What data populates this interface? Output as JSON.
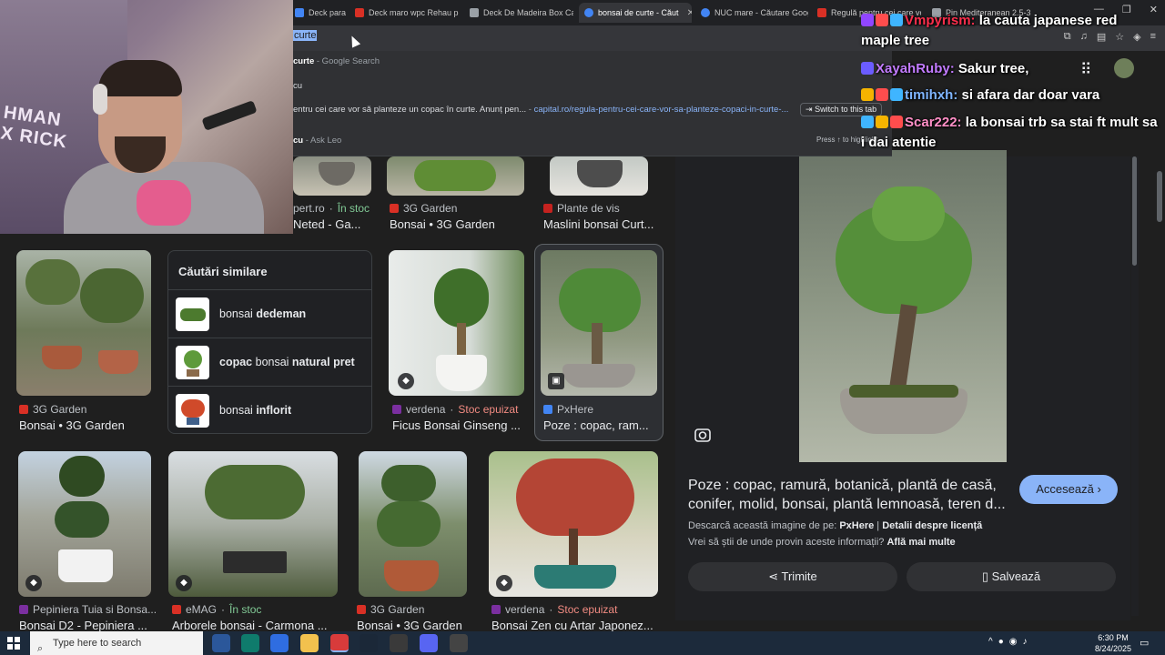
{
  "browser": {
    "tabs": [
      {
        "label": "Deck para P",
        "color": "#4285f4"
      },
      {
        "label": "Deck maro wpc Rehau pi",
        "color": "#d93025"
      },
      {
        "label": "Deck De Madeira Box Cap",
        "color": "#9aa0a6"
      },
      {
        "label": "bonsai de curte - Căut",
        "color": "#4285f4",
        "active": true
      },
      {
        "label": "NUC mare - Căutare Goog",
        "color": "#4285f4"
      },
      {
        "label": "Regulă pentru cei care vor",
        "color": "#d93025"
      },
      {
        "label": "Pin Mediteranean 2.5-3 m",
        "color": "#9aa0a6"
      }
    ],
    "omnibox_selected": "curte",
    "suggestions": {
      "s1_bold": "curte",
      "s1_rest": " - Google Search",
      "s2": "cu",
      "s3_text": "entru cei care vor să planteze un copac în curte. Anunț pen...",
      "s3_sep": " - ",
      "s3_link": "capital.ro/regula-pentru-cei-care-vor-sa-planteze-copaci-in-curte-...",
      "s4_bold": "cu",
      "s4_rest": " - Ask Leo",
      "switch_tab": "Switch to this tab",
      "press_hint": "Press ↑ to highlight"
    }
  },
  "webcam": {
    "logo_text": "HMAN X RICK"
  },
  "results": {
    "row0": [
      {
        "source": "pert.ro",
        "stock": "În stoc",
        "title": "Neted - Ga..."
      },
      {
        "source": "3G Garden",
        "title": "Bonsai • 3G Garden"
      },
      {
        "source": "Plante de vis",
        "title": "Maslini bonsai Curt..."
      }
    ],
    "row1": [
      {
        "source": "3G Garden",
        "title": "Bonsai • 3G Garden"
      },
      {
        "source": "verdena",
        "stock": "Stoc epuizat",
        "title": "Ficus Bonsai Ginseng ..."
      },
      {
        "source": "PxHere",
        "title": "Poze : copac, ram..."
      }
    ],
    "row2": [
      {
        "source": "Pepiniera Tuia si Bonsa...",
        "title": "Bonsai D2 - Pepiniera ..."
      },
      {
        "source": "eMAG",
        "stock": "În stoc",
        "title": "Arborele bonsai - Carmona ..."
      },
      {
        "source": "3G Garden",
        "title": "Bonsai • 3G Garden"
      },
      {
        "source": "verdena",
        "stock": "Stoc epuizat",
        "title": "Bonsai Zen cu Artar Japonez..."
      }
    ]
  },
  "similar": {
    "title": "Căutări similare",
    "items": [
      {
        "plain": "bonsai ",
        "bold": "dedeman",
        "plain_after": ""
      },
      {
        "plain": "",
        "bold": "copac",
        "plain_after": " bonsai ",
        "bold2": "natural pret"
      },
      {
        "plain": "bonsai ",
        "bold": "inflorit",
        "plain_after": ""
      }
    ]
  },
  "preview": {
    "title": "Poze : copac, ramură, botanică, plantă de casă, conifer, molid, bonsai, plantă lemnoasă, teren d...",
    "visit_label": "Accesează",
    "download_prefix": "Descarcă această imagine de pe: ",
    "download_source": "PxHere",
    "download_sep": " | ",
    "license": "Detalii despre licență",
    "info_prefix": "Vrei să știi de unde provin aceste informații? ",
    "info_link": "Află mai multe",
    "share_label": "Trimite",
    "save_label": "Salvează"
  },
  "chat": [
    {
      "user": "Vmpyrism:",
      "user_color": "#ff2e4c",
      "msg": " la cauta japanese red maple tree"
    },
    {
      "user": "XayahRuby:",
      "user_color": "#c27bff",
      "msg": " Sakur tree,"
    },
    {
      "user": "timihxh:",
      "user_color": "#7fb5ff",
      "msg": " si afara dar doar vara"
    },
    {
      "user": "Scar222:",
      "user_color": "#ff8fc7",
      "msg": " la bonsai trb sa stai ft mult sa i dai atentie"
    }
  ],
  "taskbar": {
    "search_placeholder": "Type here to search",
    "time": "6:30 PM",
    "date": "8/24/2025"
  }
}
